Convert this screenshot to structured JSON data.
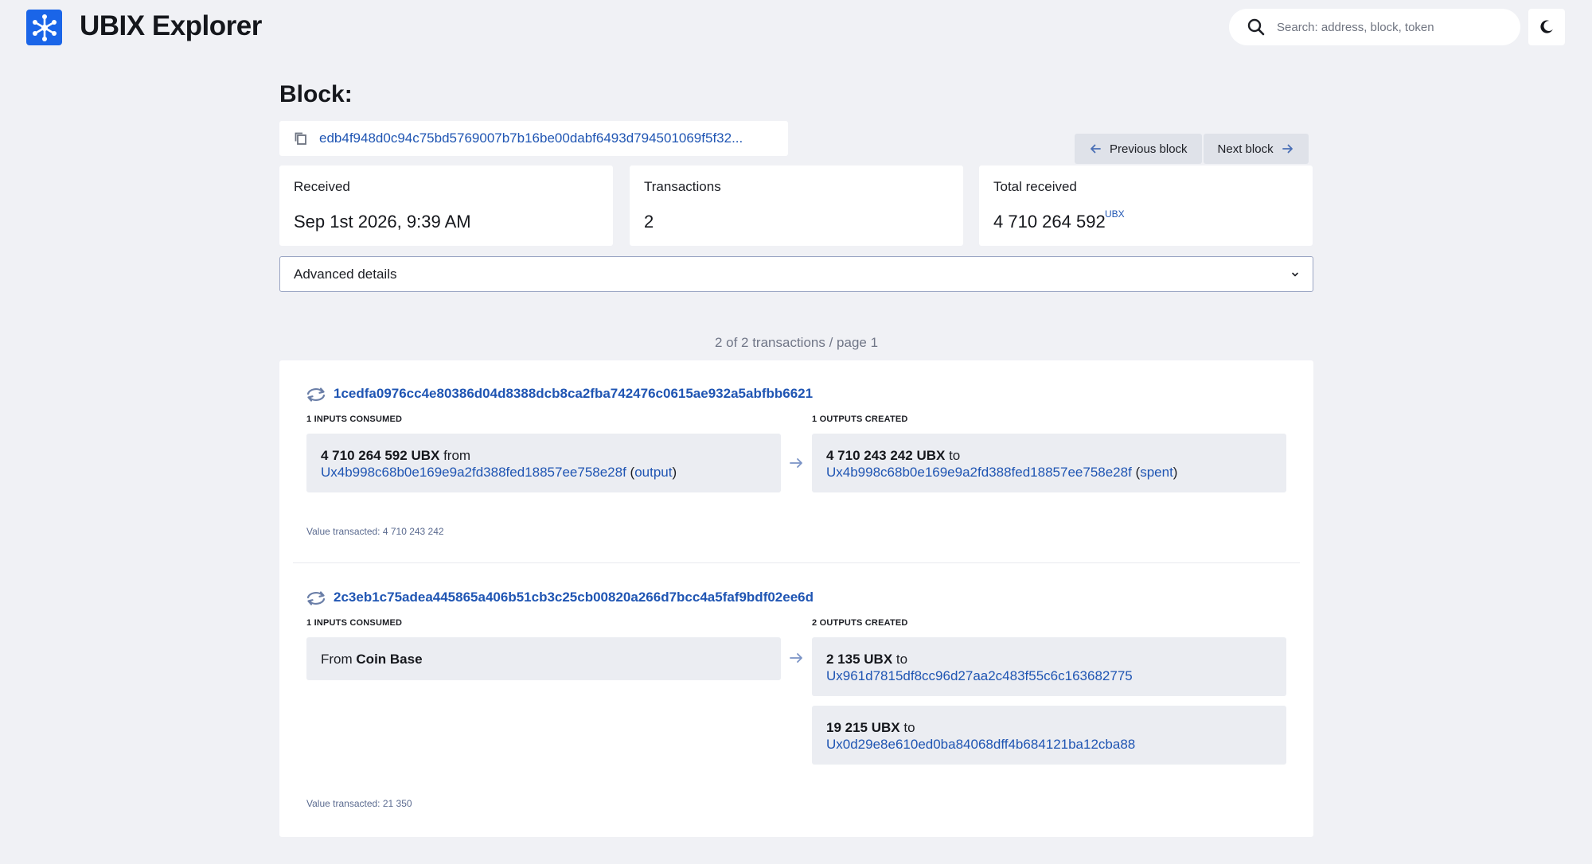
{
  "header": {
    "app_title": "UBIX Explorer",
    "search_placeholder": "Search: address, block, token"
  },
  "block": {
    "title": "Block:",
    "hash": "edb4f948d0c94c75bd5769007b7b16be00dabf6493d794501069f5f32...",
    "prev_label": "Previous block",
    "next_label": "Next block",
    "stats": [
      {
        "label": "Received",
        "value": "Sep 1st 2026, 9:39 AM"
      },
      {
        "label": "Transactions",
        "value": "2"
      },
      {
        "label": "Total received",
        "value": "4 710 264 592",
        "unit": "UBX"
      }
    ],
    "advanced_label": "Advanced details"
  },
  "pager": "2 of 2 transactions / page 1",
  "transactions": [
    {
      "hash": "1cedfa0976cc4e80386d04d8388dcb8ca2fba742476c0615ae932a5abfbb6621",
      "inputs_label": "1 INPUTS CONSUMED",
      "outputs_label": "1 OUTPUTS CREATED",
      "input": {
        "amount": "4 710 264 592 UBX",
        "word": "from",
        "address": "Ux4b998c68b0e169e9a2fd388fed18857ee758e28f",
        "tag": "output"
      },
      "output": {
        "amount": "4 710 243 242 UBX",
        "word": "to",
        "address": "Ux4b998c68b0e169e9a2fd388fed18857ee758e28f",
        "tag": "spent"
      },
      "value_note": "Value transacted: 4 710 243 242"
    },
    {
      "hash": "2c3eb1c75adea445865a406b51cb3c25cb00820a266d7bcc4a5faf9bdf02ee6d",
      "inputs_label": "1 INPUTS CONSUMED",
      "outputs_label": "2 OUTPUTS CREATED",
      "input": {
        "word": "From",
        "source": "Coin Base"
      },
      "outputs": [
        {
          "amount": "2 135 UBX",
          "word": "to",
          "address": "Ux961d7815df8cc96d27aa2c483f55c6c163682775"
        },
        {
          "amount": "19 215 UBX",
          "word": "to",
          "address": "Ux0d29e8e610ed0ba84068dff4b684121ba12cba88"
        }
      ],
      "value_note": "Value transacted: 21 350"
    }
  ],
  "colors": {
    "accent": "#1a65e8",
    "link": "#1f55b3",
    "background": "#f0f1f5"
  }
}
